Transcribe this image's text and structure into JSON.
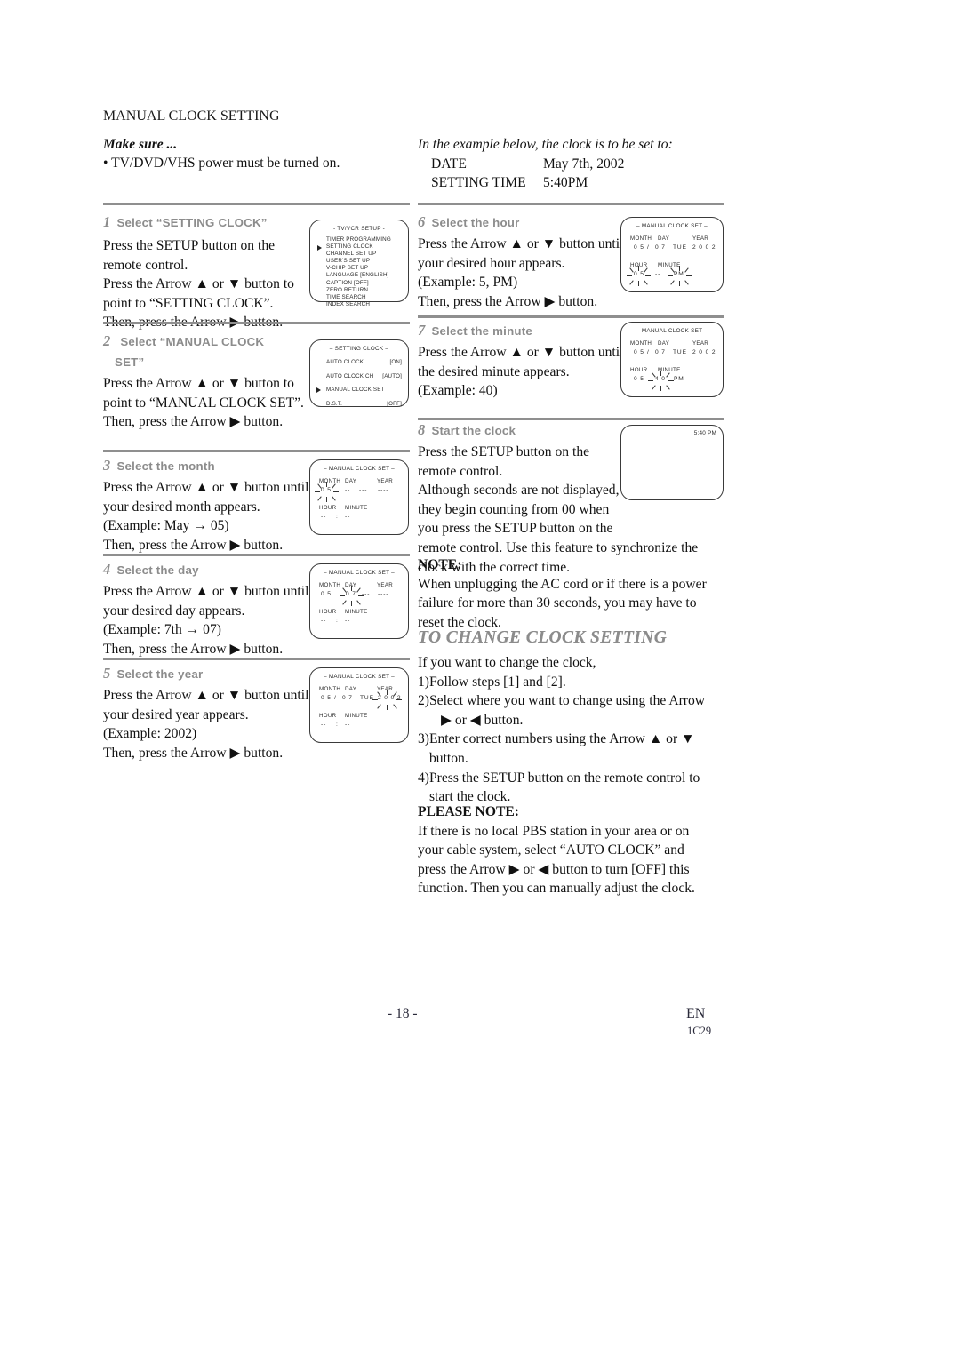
{
  "document": {
    "section_title": "MANUAL CLOCK SETTING",
    "make_sure_label": "Make sure ...",
    "make_sure_bullet": "• TV/DVD/VHS power must be turned on.",
    "example_intro": "In the example below, the clock is to be set to:",
    "example_rows": [
      {
        "label": "DATE",
        "value": "May 7th, 2002"
      },
      {
        "label": "SETTING TIME",
        "value": "5:40PM"
      }
    ]
  },
  "steps": {
    "s1": {
      "num": "1",
      "title": "Select “SETTING CLOCK”",
      "lines": [
        "Press the SETUP button on the",
        "remote control.",
        "Press the Arrow ▲ or ▼ button to",
        "point to “SETTING CLOCK”.",
        "Then, press the Arrow ▶ button."
      ]
    },
    "s2": {
      "num": "2",
      "title_line1": "Select “MANUAL CLOCK",
      "title_line2": "SET”",
      "lines": [
        "Press the Arrow ▲ or ▼ button to",
        "point to “MANUAL CLOCK SET”.",
        "Then, press the Arrow ▶ button."
      ]
    },
    "s3": {
      "num": "3",
      "title": "Select the month",
      "lines": [
        "Press the Arrow ▲ or ▼ button until",
        "your desired month appears.",
        "(Example: May → 05)",
        "Then, press the Arrow ▶ button."
      ]
    },
    "s4": {
      "num": "4",
      "title": "Select the day",
      "lines": [
        "Press the Arrow ▲ or ▼ button until",
        "your desired day appears.",
        "(Example: 7th → 07)",
        "Then, press the Arrow ▶ button."
      ]
    },
    "s5": {
      "num": "5",
      "title": "Select the year",
      "lines": [
        "Press the Arrow ▲ or ▼ button until",
        "your desired year appears.",
        "(Example: 2002)",
        "Then, press the Arrow ▶ button."
      ]
    },
    "s6": {
      "num": "6",
      "title": "Select the hour",
      "lines": [
        "Press the Arrow ▲ or ▼ button until",
        "your desired hour appears.",
        "(Example: 5, PM)",
        "Then, press the Arrow ▶ button."
      ]
    },
    "s7": {
      "num": "7",
      "title": "Select the minute",
      "lines": [
        "Press the Arrow ▲ or ▼ button until",
        "the desired minute appears.",
        "(Example: 40)"
      ]
    },
    "s8": {
      "num": "8",
      "title": "Start the clock",
      "lines": [
        "Press the SETUP button on the",
        "remote control.",
        "Although seconds are not displayed,",
        "they begin counting from 00 when",
        "you press the SETUP button on the",
        "remote control. Use this feature to synchronize the",
        "clock with the correct time."
      ]
    }
  },
  "osd": {
    "tvvcr_setup": {
      "title": "- TV/VCR SETUP -",
      "items": [
        {
          "label": "TIMER PROGRAMMING",
          "cursor": false
        },
        {
          "label": "SETTING CLOCK",
          "cursor": true
        },
        {
          "label": "CHANNEL SET UP",
          "cursor": false
        },
        {
          "label": "USER'S SET UP",
          "cursor": false
        },
        {
          "label": "V-CHIP SET UP",
          "cursor": false
        },
        {
          "label": "LANGUAGE  [ENGLISH]",
          "cursor": false
        },
        {
          "label": "CAPTION  [OFF]",
          "cursor": false
        },
        {
          "label": "ZERO RETURN",
          "cursor": false
        },
        {
          "label": "TIME SEARCH",
          "cursor": false
        },
        {
          "label": "INDEX SEARCH",
          "cursor": false
        }
      ]
    },
    "setting_clock": {
      "title": "– SETTING CLOCK –",
      "items": [
        {
          "label": "AUTO CLOCK",
          "value": "[ON]",
          "cursor": false
        },
        {
          "label": "AUTO CLOCK CH",
          "value": "[AUTO]",
          "cursor": false
        },
        {
          "label": "MANUAL CLOCK SET",
          "value": "",
          "cursor": true
        },
        {
          "label": "D.S.T.",
          "value": "[OFF]",
          "cursor": false
        }
      ]
    },
    "manual_clock_set": {
      "title": "– MANUAL CLOCK SET –",
      "labels": {
        "month": "MONTH",
        "day": "DAY",
        "year": "YEAR",
        "hour": "HOUR",
        "minute": "MINUTE"
      },
      "step3": {
        "month": "0 5",
        "day": "--",
        "weekday": "---",
        "year": "----",
        "hour": "--",
        "minute": "--",
        "ampm": "",
        "blink": "month"
      },
      "step4": {
        "month": "0 5",
        "day": "0 7",
        "weekday": "---",
        "year": "----",
        "hour": "--",
        "minute": "--",
        "ampm": "",
        "blink": "day"
      },
      "step5": {
        "month": "0 5",
        "day": "0 7",
        "weekday": "TUE",
        "year": "2 0 0 2",
        "hour": "--",
        "minute": "--",
        "ampm": "",
        "blink": "year"
      },
      "step6": {
        "month": "0 5",
        "day": "0 7",
        "weekday": "TUE",
        "year": "2 0 0 2",
        "hour": "0 5",
        "minute": "--",
        "ampm": "PM",
        "blink": "hour"
      },
      "step7": {
        "month": "0 5",
        "day": "0 7",
        "weekday": "TUE",
        "year": "2 0 0 2",
        "hour": "0 5",
        "minute": "4 0",
        "ampm": "PM",
        "blink": "minute"
      },
      "separator_slash": "/",
      "separator_colon": ":"
    },
    "clock_display": {
      "time": "5:40 PM"
    }
  },
  "note": {
    "heading": "NOTE:",
    "lines": [
      "When unplugging the AC cord or if there is a power",
      "failure for more than 30 seconds, you may have to",
      "reset the clock."
    ]
  },
  "change_section": {
    "title": "TO CHANGE CLOCK SETTING",
    "intro": "If you want to change the clock,",
    "items": [
      "1)Follow steps [1] and [2].",
      "2)Select where you want to change using the Arrow",
      "▶ or ◀ button.",
      "3)Enter correct numbers using the Arrow ▲ or ▼",
      "button.",
      "4)Press the SETUP button on the remote control to",
      "start the clock."
    ]
  },
  "please_note": {
    "heading": "PLEASE NOTE:",
    "lines": [
      "If there is no local PBS station in your area or on",
      "your cable system, select “AUTO CLOCK” and",
      "press the Arrow ▶ or ◀ button to turn [OFF] this",
      "function. Then you can manually adjust the clock."
    ]
  },
  "footer": {
    "page": "- 18 -",
    "lang": "EN",
    "code": "1C29"
  }
}
